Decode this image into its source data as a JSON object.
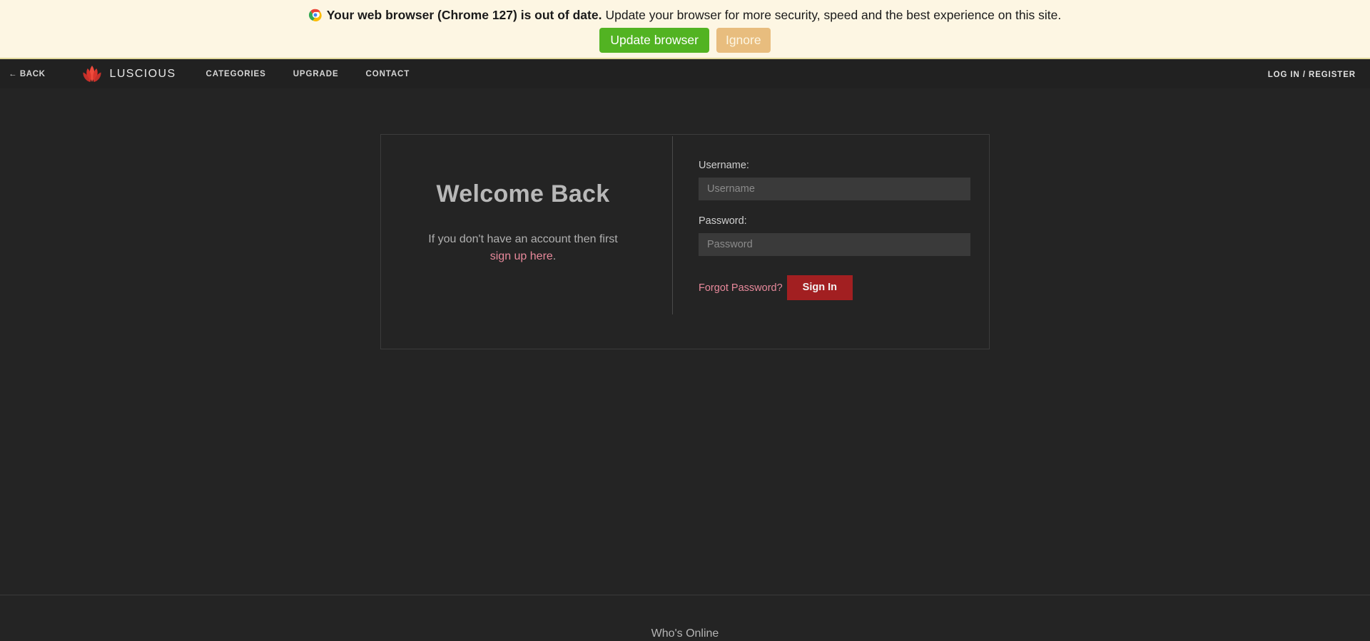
{
  "browser_banner": {
    "icon": "chrome-icon",
    "message_bold": "Your web browser (Chrome 127) is out of date.",
    "message_rest": "Update your browser for more security, speed and the best experience on this site.",
    "update_label": "Update browser",
    "ignore_label": "Ignore",
    "background_color": "#fdf6e3",
    "update_button_color": "#52b322",
    "ignore_button_color": "#e8bd7e"
  },
  "navbar": {
    "back_label": "← BACK",
    "brand_name": "LUSCIOUS",
    "brand_icon": "lotus-icon",
    "links": [
      {
        "label": "CATEGORIES"
      },
      {
        "label": "UPGRADE"
      },
      {
        "label": "CONTACT"
      }
    ],
    "login_label": "LOG IN / REGISTER",
    "background_color": "#212121"
  },
  "login_card": {
    "welcome_title": "Welcome Back",
    "signup_text_before": "If you don't have an account then first ",
    "signup_link": "sign up here",
    "signup_text_after": ".",
    "username_label": "Username:",
    "username_placeholder": "Username",
    "username_value": "",
    "password_label": "Password:",
    "password_placeholder": "Password",
    "password_value": "",
    "forgot_label": "Forgot Password?",
    "signin_label": "Sign In",
    "signin_button_color": "#a21f21",
    "link_color": "#e8899b"
  },
  "footer": {
    "whos_online_label": "Who's Online"
  },
  "theme": {
    "page_background": "#242424",
    "card_border": "#3c3c3c",
    "input_background": "#3a3a3a"
  }
}
